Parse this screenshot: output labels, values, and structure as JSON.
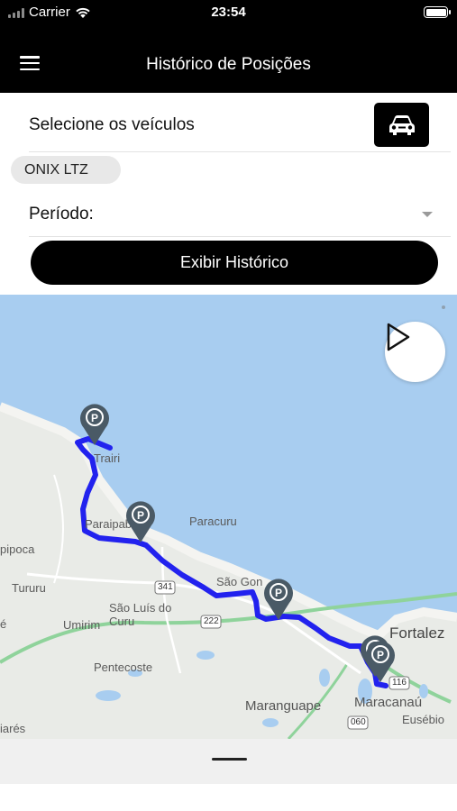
{
  "status_bar": {
    "carrier": "Carrier",
    "time": "23:54"
  },
  "nav": {
    "title": "Histórico de Posições",
    "menu_icon": "menu-icon"
  },
  "form": {
    "vehicle_label": "Selecione os veículos",
    "vehicle_button_icon": "car-icon",
    "selected_vehicle": "ONIX LTZ",
    "period_label": "Período:",
    "submit_label": "Exibir Histórico"
  },
  "map": {
    "labels": {
      "trairi": "Trairi",
      "paraipaba": "Paraipab",
      "paracuru": "Paracuru",
      "itapipoca": "pipoca",
      "tururu": "Tururu",
      "sao_luis": "São Luís do",
      "curu": "Curu",
      "umirim": "Umirim",
      "sao_goncalo": "São Gon",
      "pentecoste": "Pentecoste",
      "maranguape": "Maranguape",
      "maracanau": "Maracanaú",
      "fortaleza": "Fortalez",
      "eusebio": "Eusébio",
      "tejucuoca": "é",
      "irauçuba": "iarés"
    },
    "road_shields": [
      "341",
      "222",
      "116",
      "060"
    ],
    "route_color": "#2222ee",
    "parking_pin_icon": "parking-pin-icon",
    "play_icon": "play-icon"
  },
  "colors": {
    "sea": "#a8cdf0",
    "land": "#e9ebe7",
    "route": "#2222ee",
    "pin": "#4a5a66"
  }
}
